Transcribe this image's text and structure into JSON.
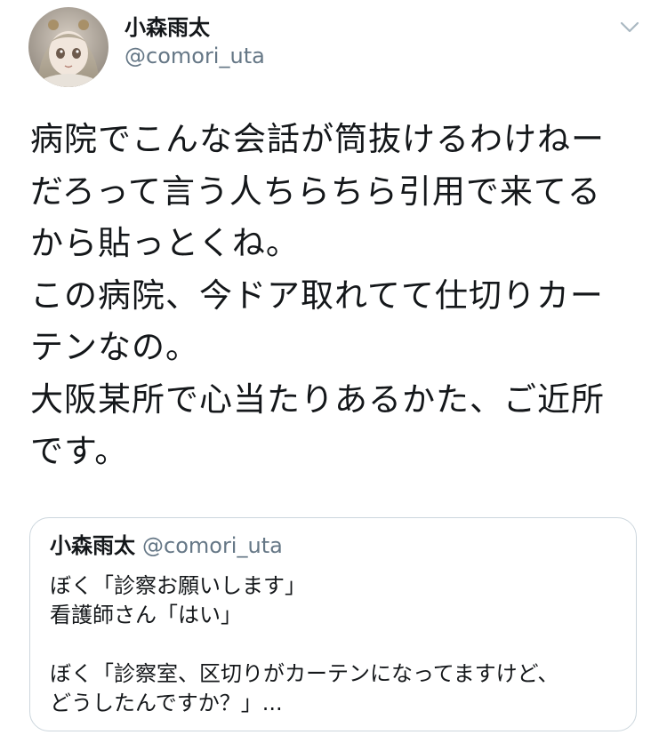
{
  "tweet": {
    "author": {
      "display_name": "小森雨太",
      "handle": "@comori_uta",
      "avatar_icon": "avatar-image"
    },
    "menu_icon": "chevron-down-icon",
    "text_lines": [
      "病院でこんな会話が筒抜けるわけねー",
      "だろって言う人ちらちら引用で来てる",
      "から貼っとくね。",
      "この病院、今ドア取れてて仕切りカー",
      "テンなの。",
      "大阪某所で心当たりあるかた、ご近所",
      "です。"
    ]
  },
  "quoted_tweet": {
    "display_name": "小森雨太",
    "handle": "@comori_uta",
    "text_lines": [
      "ぼく「診察お願いします」",
      "看護師さん「はい」",
      "",
      "ぼく「診察室、区切りがカーテンになってますけど、",
      "どうしたんですか？」..."
    ]
  },
  "colors": {
    "text_primary": "#14171a",
    "text_secondary": "#657786",
    "border": "#ccd6dd",
    "chevron": "#aab8c2"
  }
}
